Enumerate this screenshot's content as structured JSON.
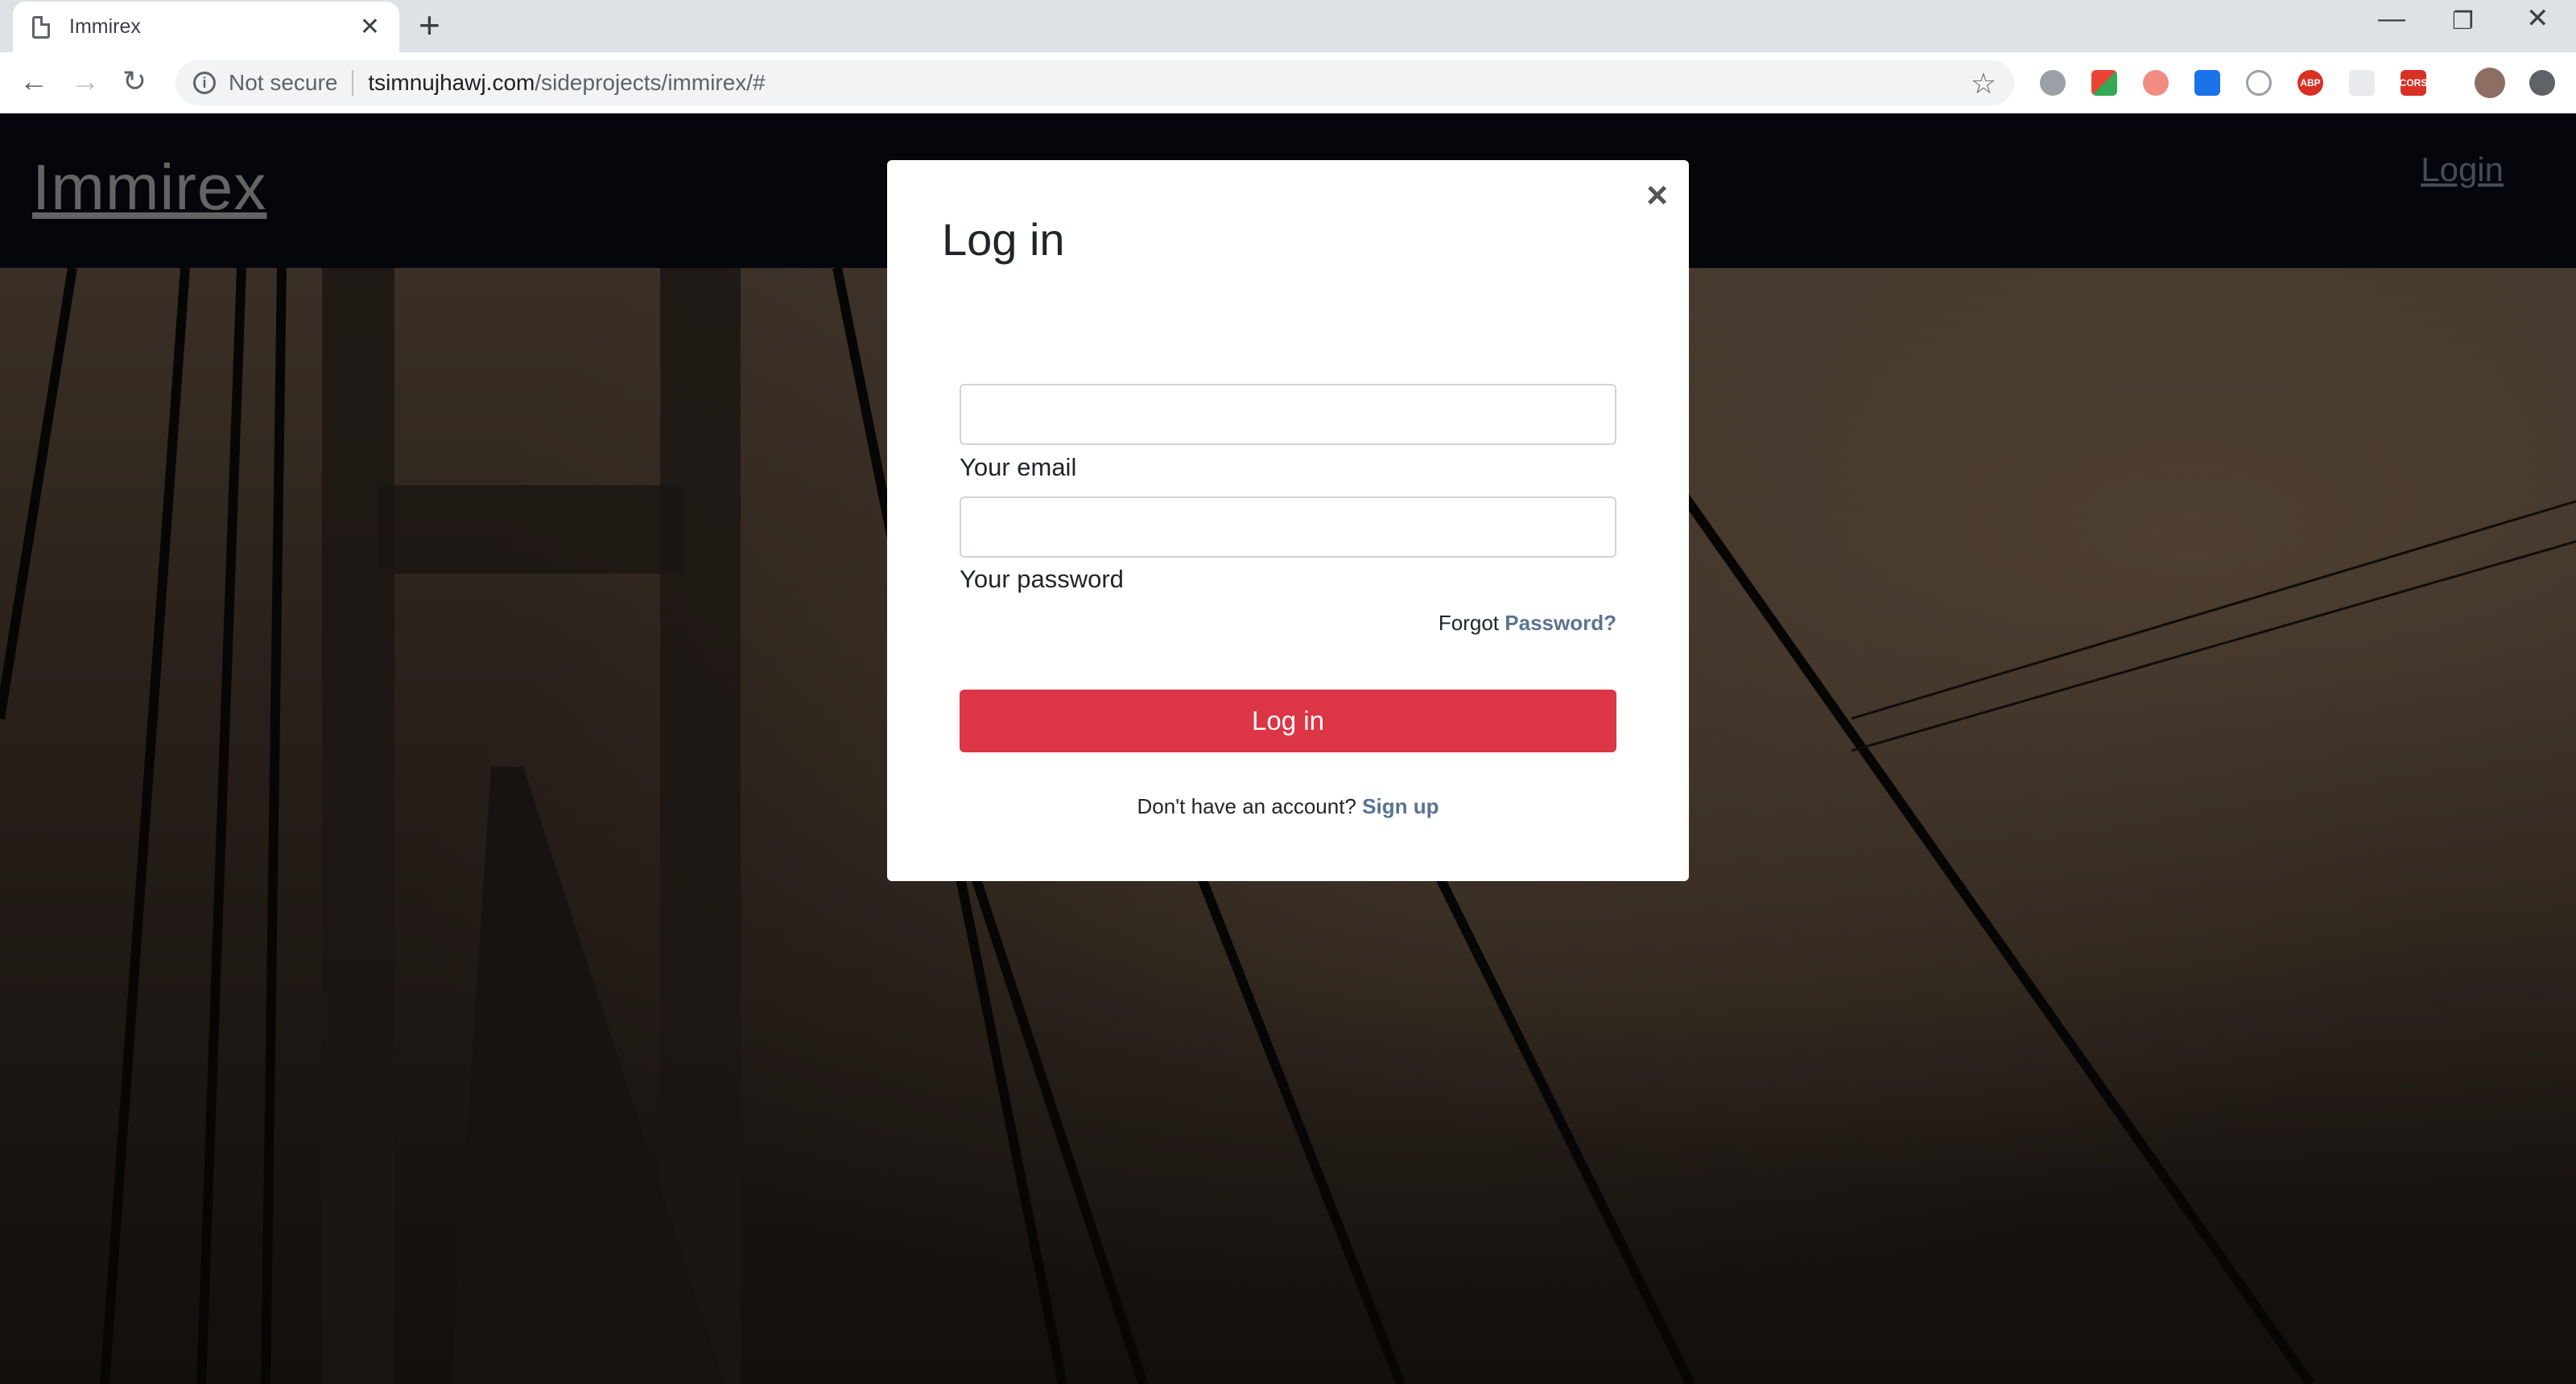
{
  "browser": {
    "tab_title": "Immirex",
    "not_secure": "Not secure",
    "url_host": "tsimnujhawj.com",
    "url_path": "/sideprojects/immirex/#"
  },
  "navbar": {
    "brand": "Immirex",
    "login_link": "Login"
  },
  "modal": {
    "title": "Log in",
    "close": "×",
    "email_label": "Your email",
    "email_value": "",
    "password_label": "Your password",
    "password_value": "",
    "forgot_text": "Forgot",
    "forgot_link": "Password?",
    "submit_label": "Log in",
    "signup_text": "Don't have an account?",
    "signup_link": "Sign up"
  },
  "colors": {
    "navbar_bg": "#070a12",
    "primary_button": "#dc3545",
    "link": "#5a7391"
  }
}
